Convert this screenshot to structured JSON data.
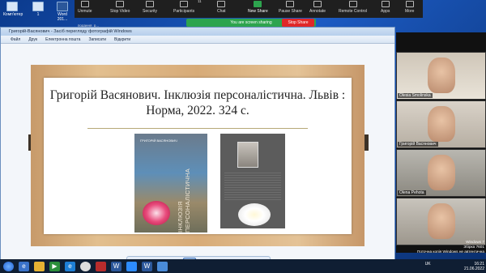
{
  "desktop": {
    "icons": [
      {
        "label": "Комп'ютер"
      },
      {
        "label": "1"
      },
      {
        "label": "Word 201..."
      }
    ]
  },
  "zoom": {
    "buttons": [
      {
        "label": "Unmute",
        "icon": "mic-off-icon"
      },
      {
        "label": "Stop Video",
        "icon": "camera-icon"
      },
      {
        "label": "Security",
        "icon": "shield-icon"
      },
      {
        "label": "Participants",
        "icon": "people-icon",
        "count": "11"
      },
      {
        "label": "Chat",
        "icon": "chat-icon"
      },
      {
        "label": "New Share",
        "icon": "share-icon"
      },
      {
        "label": "Pause Share",
        "icon": "pause-icon"
      },
      {
        "label": "Annotate",
        "icon": "pen-icon"
      },
      {
        "label": "Remote Control",
        "icon": "mouse-icon"
      },
      {
        "label": "Apps",
        "icon": "apps-icon"
      },
      {
        "label": "More",
        "icon": "more-icon"
      }
    ],
    "sharing_text": "You are screen sharing",
    "stop_share": "Stop Share",
    "taskbar_item": "подання_p..."
  },
  "viewer": {
    "title": "Григорій-Васянович - Засіб перегляду фотографій Windows",
    "menu": [
      "Файл",
      "Друк",
      "Електронна пошта",
      "Записати",
      "Відкрити"
    ],
    "slide": {
      "title": "Григорій Васянович. Інклюзія персоналістична. Львів : Норма, 2022. 324 с.",
      "book1_author": "ГРИГОРІЙ ВАСЯНОВИЧ",
      "book1_title": "ІНКЛЮЗІЯ ПЕРСОНАЛІСТИЧНА"
    },
    "toolbar": [
      "zoom-icon",
      "fit-icon",
      "prev-icon",
      "slideshow-icon",
      "next-icon",
      "rotate-left-icon",
      "rotate-right-icon",
      "delete-icon"
    ]
  },
  "participants": [
    {
      "name": "Olesia Smolinska"
    },
    {
      "name": "Григорій Васянович"
    },
    {
      "name": "Olena Pehota"
    },
    {
      "name": ""
    }
  ],
  "watermark": {
    "line1": "Windows 7",
    "line2": "Збірка 7601",
    "line3": "Поточна копія Windows не автентична"
  },
  "taskbar": {
    "lang": "UK",
    "time": "16:21",
    "date": "21.06.2022"
  }
}
